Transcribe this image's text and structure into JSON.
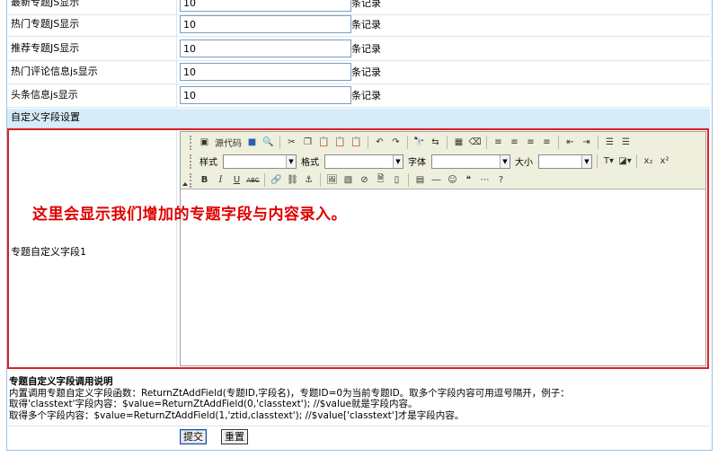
{
  "rows": [
    {
      "label": "最新专题JS显示",
      "value": "10",
      "unit": "条记录"
    },
    {
      "label": "热门专题JS显示",
      "value": "10",
      "unit": "条记录"
    },
    {
      "label": "推荐专题JS显示",
      "value": "10",
      "unit": "条记录"
    },
    {
      "label": "热门评论信息js显示",
      "value": "10",
      "unit": "条记录"
    },
    {
      "label": "头条信息js显示",
      "value": "10",
      "unit": "条记录"
    }
  ],
  "section_title": "自定义字段设置",
  "custom_field_label": "专题自定义字段1",
  "editor": {
    "source_label": "源代码",
    "style_label": "样式",
    "format_label": "格式",
    "font_label": "字体",
    "size_label": "大小"
  },
  "overlay_text": "这里会显示我们增加的专题字段与内容录入。",
  "help": {
    "title": "专题自定义字段调用说明",
    "line1": "内置调用专题自定义字段函数：ReturnZtAddField(专题ID,字段名)，专题ID=0为当前专题ID。取多个字段内容可用逗号隔开，例子：",
    "line2": "取得'classtext'字段内容：$value=ReturnZtAddField(0,'classtext'); //$value就是字段内容。",
    "line3": "取得多个字段内容：$value=ReturnZtAddField(1,'ztid,classtext'); //$value['classtext']才是字段内容。"
  },
  "buttons": {
    "submit": "提交",
    "reset": "重置"
  },
  "colors": {
    "overlay": "#e00000",
    "highlight_border": "#dd2222",
    "section_bg": "#d7ecf9"
  }
}
